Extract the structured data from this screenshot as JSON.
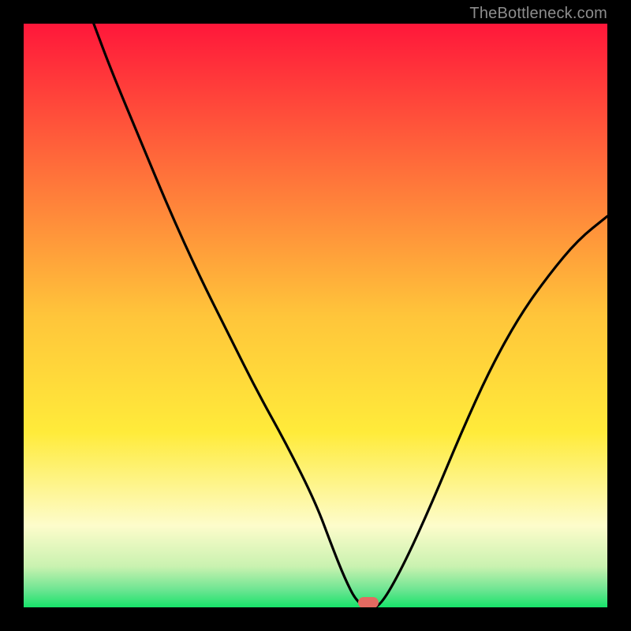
{
  "watermark": "TheBottleneck.com",
  "chart_data": {
    "type": "line",
    "title": "",
    "xlabel": "",
    "ylabel": "",
    "xlim": [
      0,
      100
    ],
    "ylim": [
      0,
      100
    ],
    "grid": false,
    "series": [
      {
        "name": "bottleneck-curve",
        "x": [
          12,
          15,
          20,
          25,
          30,
          35,
          40,
          45,
          50,
          53,
          55,
          57,
          59,
          61,
          65,
          70,
          75,
          80,
          85,
          90,
          95,
          100
        ],
        "values": [
          100,
          92,
          80,
          68,
          57,
          47,
          37,
          28,
          18,
          10,
          5,
          1,
          0,
          0,
          7,
          18,
          30,
          41,
          50,
          57,
          63,
          67
        ]
      }
    ],
    "optimal_marker": {
      "x": 59,
      "y": 0
    },
    "gradient_stops": [
      {
        "pos": 0,
        "color": "#ff173a"
      },
      {
        "pos": 0.25,
        "color": "#ff6f3a"
      },
      {
        "pos": 0.5,
        "color": "#ffc53a"
      },
      {
        "pos": 0.7,
        "color": "#ffeb3a"
      },
      {
        "pos": 0.86,
        "color": "#fdfccb"
      },
      {
        "pos": 0.93,
        "color": "#c9f2b0"
      },
      {
        "pos": 0.97,
        "color": "#6de592"
      },
      {
        "pos": 1.0,
        "color": "#17e36a"
      }
    ]
  }
}
